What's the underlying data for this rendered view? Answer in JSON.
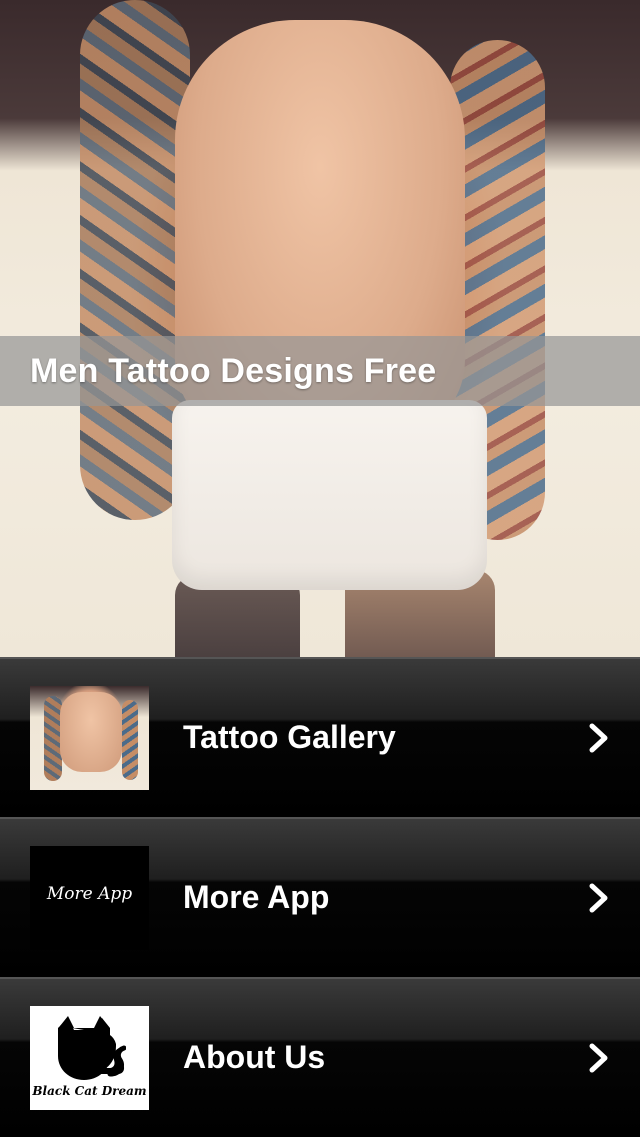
{
  "hero": {
    "title": "Men Tattoo Designs Free"
  },
  "menu": {
    "items": [
      {
        "label": "Tattoo Gallery",
        "icon": "chevron-right-icon"
      },
      {
        "label": "More App",
        "icon": "chevron-right-icon",
        "thumb_text": "More App"
      },
      {
        "label": "About Us",
        "icon": "chevron-right-icon",
        "thumb_text": "Black Cat Dream"
      }
    ]
  }
}
